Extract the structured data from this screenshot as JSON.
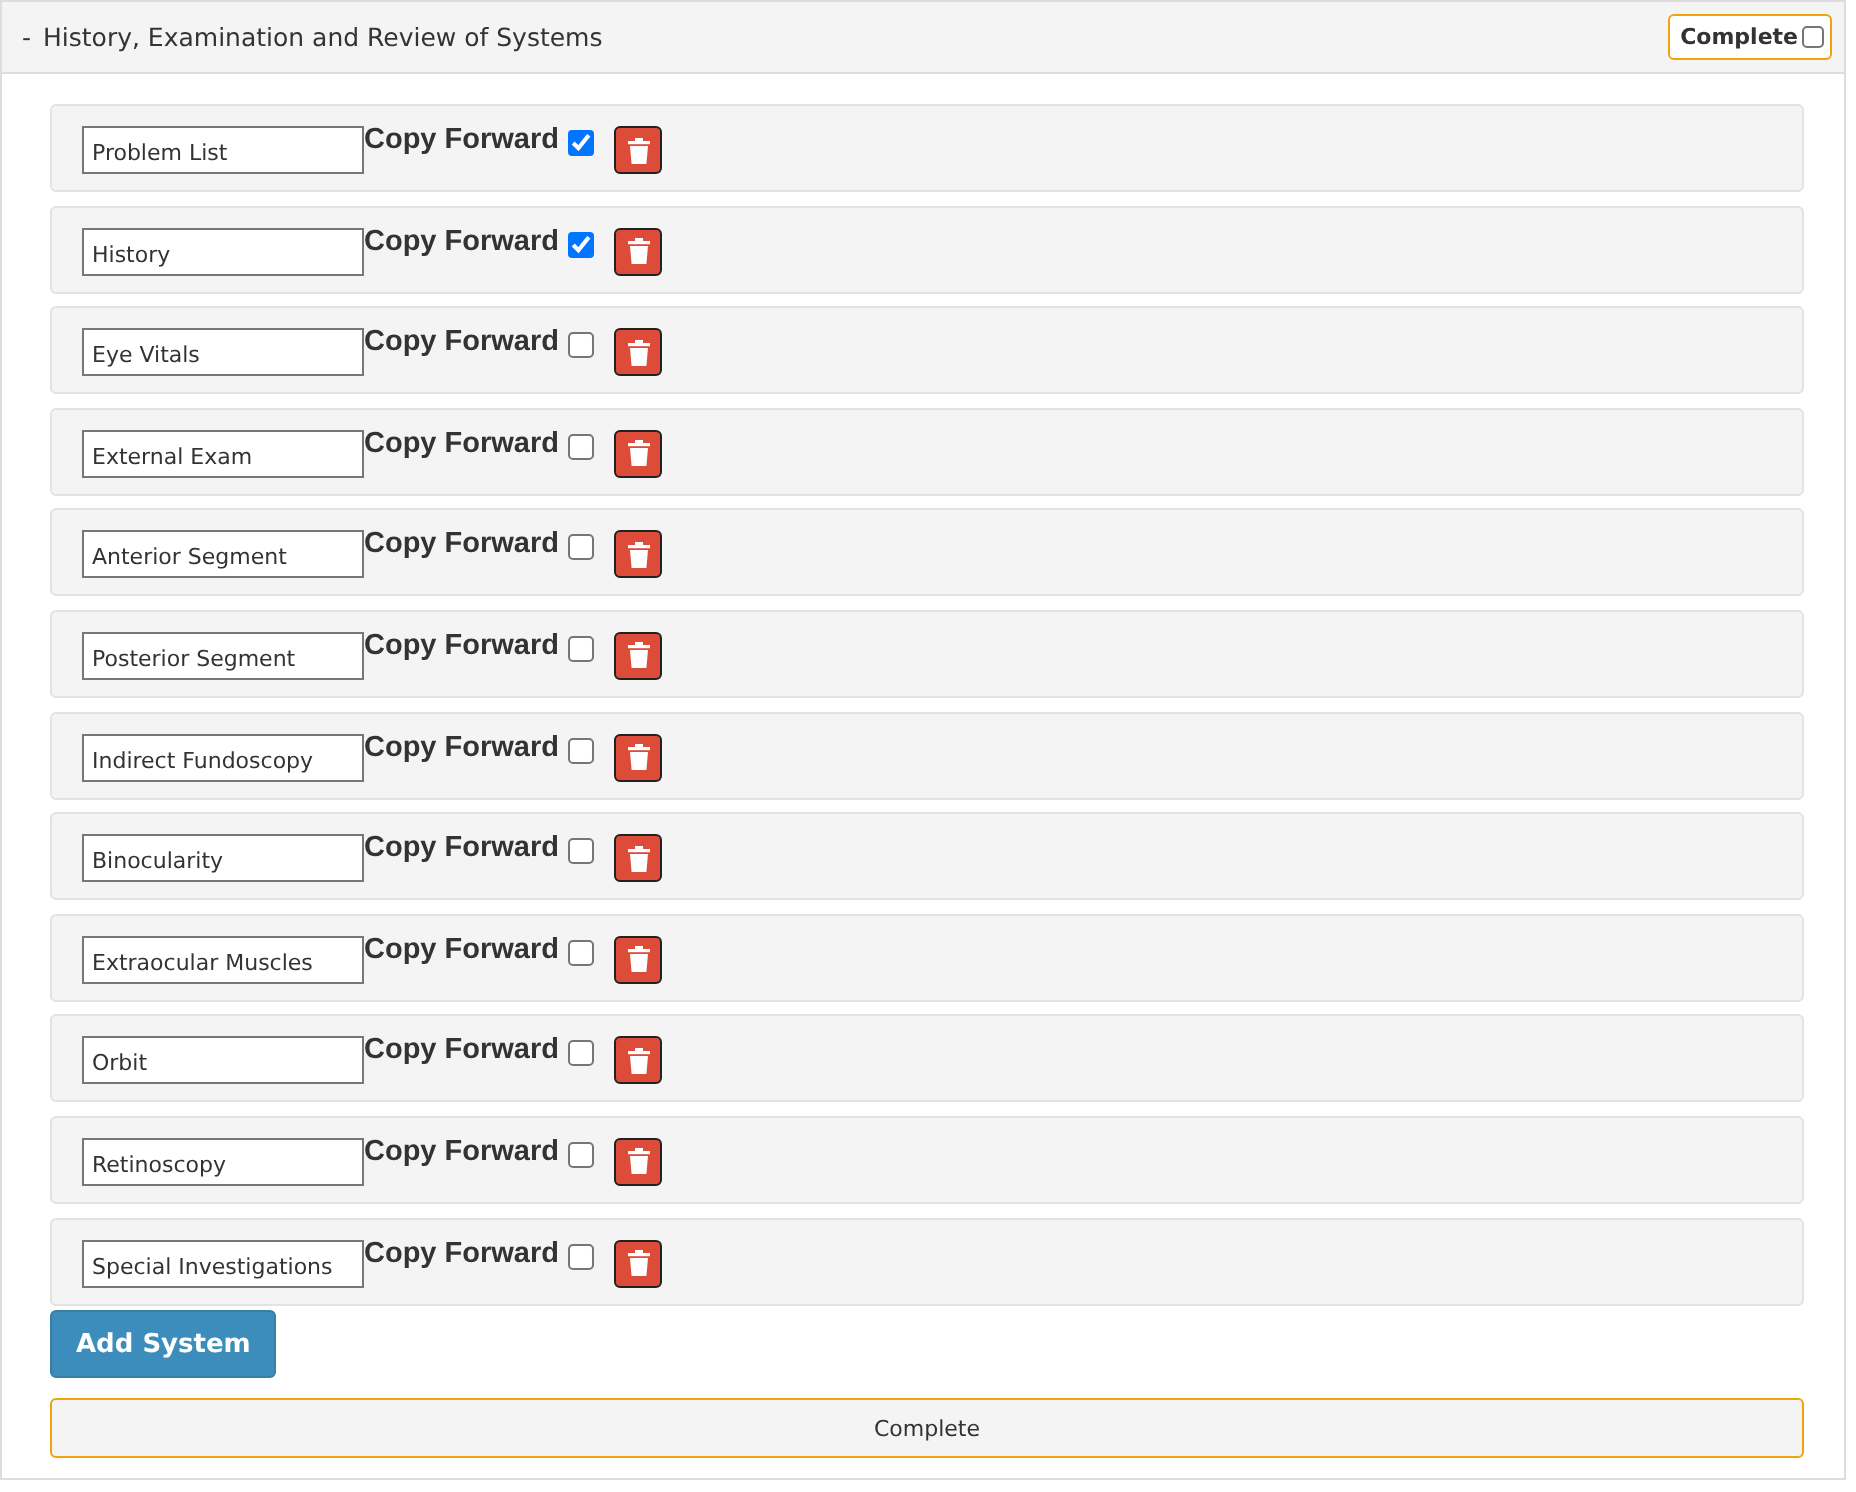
{
  "panel": {
    "collapse_symbol": "-",
    "title": "History, Examination and Review of Systems",
    "complete_label": "Complete",
    "complete_checked": false
  },
  "systems": [
    {
      "name": "Problem List",
      "copy_label": "Copy Forward",
      "copy_forward": true
    },
    {
      "name": "History",
      "copy_label": "Copy Forward",
      "copy_forward": true
    },
    {
      "name": "Eye Vitals",
      "copy_label": "Copy Forward",
      "copy_forward": false
    },
    {
      "name": "External Exam",
      "copy_label": "Copy Forward",
      "copy_forward": false
    },
    {
      "name": "Anterior Segment",
      "copy_label": "Copy Forward",
      "copy_forward": false
    },
    {
      "name": "Posterior Segment",
      "copy_label": "Copy Forward",
      "copy_forward": false
    },
    {
      "name": "Indirect Fundoscopy",
      "copy_label": "Copy Forward",
      "copy_forward": false
    },
    {
      "name": "Binocularity",
      "copy_label": "Copy Forward",
      "copy_forward": false
    },
    {
      "name": "Extraocular Muscles",
      "copy_label": "Copy Forward",
      "copy_forward": false
    },
    {
      "name": "Orbit",
      "copy_label": "Copy Forward",
      "copy_forward": false
    },
    {
      "name": "Retinoscopy",
      "copy_label": "Copy Forward",
      "copy_forward": false
    },
    {
      "name": "Special Investigations",
      "copy_label": "Copy Forward",
      "copy_forward": false
    }
  ],
  "add_button": "Add System",
  "complete_button": "Complete"
}
